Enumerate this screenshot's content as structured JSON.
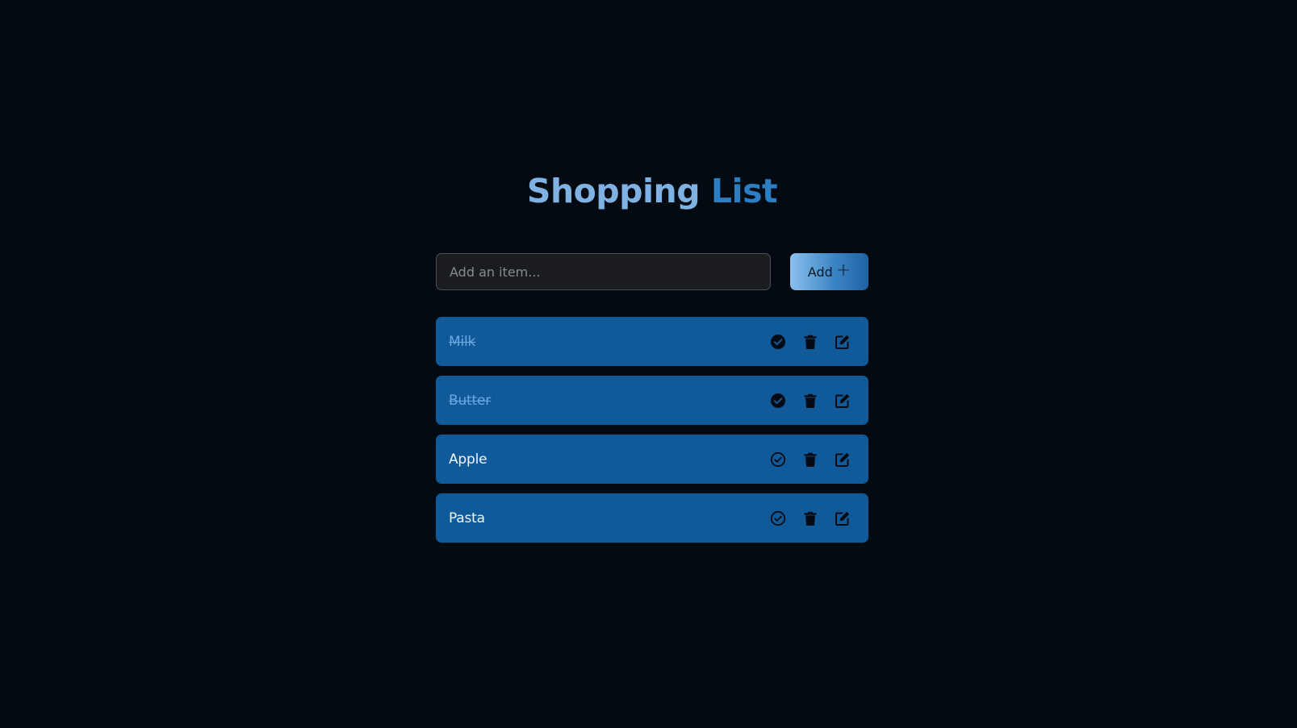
{
  "header": {
    "title_part1": "Shopping",
    "title_part2": "List"
  },
  "add_form": {
    "placeholder": "Add an item...",
    "value": "",
    "button_label": "Add",
    "button_icon": "plus-icon"
  },
  "items": [
    {
      "label": "Milk",
      "completed": true
    },
    {
      "label": "Butter",
      "completed": true
    },
    {
      "label": "Apple",
      "completed": false
    },
    {
      "label": "Pasta",
      "completed": false
    }
  ],
  "item_actions": {
    "complete_icon_done": "check-circle-filled-icon",
    "complete_icon_open": "check-circle-outline-icon",
    "delete_icon": "trash-icon",
    "edit_icon": "edit-icon"
  },
  "colors": {
    "background": "#040a11",
    "item_background": "#115a9a",
    "title_primary": "#7fb2e3",
    "title_accent": "#2c7dc2",
    "completed_text": "#69a9e2",
    "icon": "#050b14"
  }
}
